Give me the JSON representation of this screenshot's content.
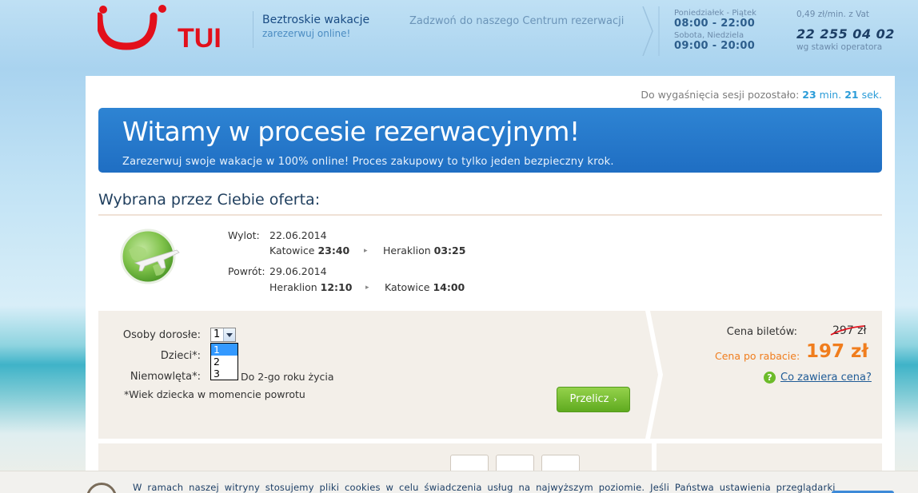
{
  "header": {
    "logo_text": "TUI",
    "tagline_main": "Beztroskie wakacje",
    "tagline_sub": "zarezerwuj online!",
    "call_text": "Zadzwoń do naszego Centrum rezerwacji",
    "weekday_label": "Poniedziałek - Piątek",
    "weekday_hours": "08:00 - 22:00",
    "weekend_label": "Sobota, Niedziela",
    "weekend_hours": "09:00 - 20:00",
    "rate_text": "0,49 zł/min. z Vat",
    "phone": "22 255 04 02",
    "operator_note": "wg stawki operatora"
  },
  "session": {
    "prefix": "Do wygaśnięcia sesji pozostało:",
    "minutes": "23",
    "min_unit": "min.",
    "seconds": "21",
    "sec_unit": "sek."
  },
  "banner": {
    "title": "Witamy w procesie rezerwacyjnym!",
    "subtitle": "Zarezerwuj swoje wakacje w 100% online! Proces zakupowy to tylko jeden bezpieczny krok."
  },
  "offer": {
    "title": "Wybrana przez Ciebie oferta:",
    "departure": {
      "label": "Wylot:",
      "date": "22.06.2014",
      "from_city": "Katowice",
      "from_time": "23:40",
      "to_city": "Heraklion",
      "to_time": "03:25"
    },
    "return": {
      "label": "Powrót:",
      "date": "29.06.2014",
      "from_city": "Heraklion",
      "from_time": "12:10",
      "to_city": "Katowice",
      "to_time": "14:00"
    }
  },
  "form": {
    "adults_label": "Osoby dorosłe:",
    "adults_value": "1",
    "adults_options": [
      "1",
      "2",
      "3"
    ],
    "children_label": "Dzieci*:",
    "infants_label": "Niemowlęta*:",
    "infants_note": "Do 2-go roku życia",
    "age_note": "*Wiek dziecka w momencie powrotu",
    "recalc_label": "Przelicz",
    "recalc_chevron": "›"
  },
  "price": {
    "ticket_label": "Cena biletów:",
    "old_price": "297 zł",
    "discount_label": "Cena po rabacie:",
    "new_price": "197 zł",
    "help_icon_glyph": "?",
    "help_link": "Co zawiera cena?"
  },
  "cookie": {
    "text": "W ramach naszej witryny stosujemy pliki cookies w celu świadczenia usług na najwyższym poziomie. Jeśli Państwa ustawienia przeglądarki"
  },
  "colors": {
    "tui_red": "#e2101b",
    "banner_blue": "#2479c9",
    "accent_orange": "#f07d1d",
    "button_green": "#6fb82e",
    "session_blue": "#2b9cd8"
  }
}
